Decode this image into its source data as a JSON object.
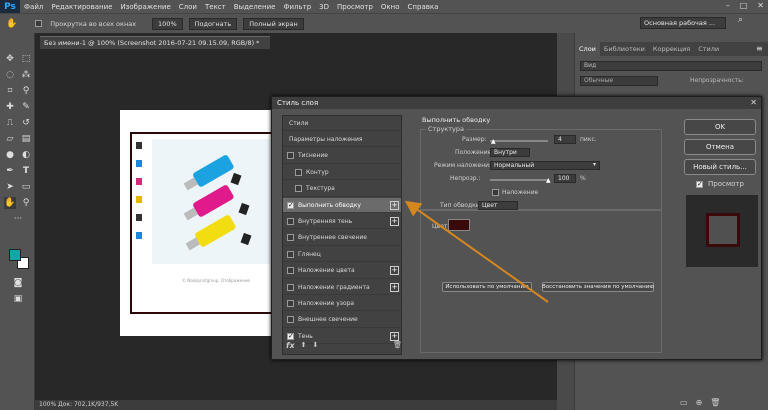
{
  "menubar": {
    "logo": "Ps",
    "items": [
      "Файл",
      "Редактирование",
      "Изображение",
      "Слои",
      "Текст",
      "Выделение",
      "Фильтр",
      "3D",
      "Просмотр",
      "Окно",
      "Справка"
    ]
  },
  "options": {
    "scroll_all_windows": "Прокрутка во всех окнах",
    "zoom": "100%",
    "fit_button": "Подогнать",
    "fullscreen_button": "Полный экран"
  },
  "search_placeholder": "Основная рабочая ...",
  "doc_tab": "Без имени-1 @ 100% (Screenshot 2016-07-21 09.15.09, RGB/8) *",
  "statusbar": "100%      Док: 702,1K/937,5K",
  "panel_tabs": [
    "Слои",
    "Библиотеки",
    "Коррекция",
    "Стили"
  ],
  "layers_panel": {
    "search": "Вид",
    "mode": "Обычные",
    "opacity_label": "Непрозрачность:"
  },
  "canvas_caption": "© Nakoprintgroup. Отображение",
  "dialog": {
    "title": "Стиль слоя",
    "styles": [
      {
        "label": "Стили",
        "check": false,
        "plus": false,
        "indent": false,
        "selected": false
      },
      {
        "label": "Параметры наложения",
        "check": false,
        "plus": false,
        "indent": false,
        "selected": false
      },
      {
        "label": "Тиснение",
        "check": true,
        "checked": false,
        "plus": false,
        "indent": false,
        "selected": false
      },
      {
        "label": "Контур",
        "check": true,
        "checked": false,
        "plus": false,
        "indent": true,
        "selected": false
      },
      {
        "label": "Текстура",
        "check": true,
        "checked": false,
        "plus": false,
        "indent": true,
        "selected": false
      },
      {
        "label": "Выполнить обводку",
        "check": true,
        "checked": true,
        "plus": true,
        "indent": false,
        "selected": true
      },
      {
        "label": "Внутренняя тень",
        "check": true,
        "checked": false,
        "plus": true,
        "indent": false,
        "selected": false
      },
      {
        "label": "Внутреннее свечение",
        "check": true,
        "checked": false,
        "plus": false,
        "indent": false,
        "selected": false
      },
      {
        "label": "Глянец",
        "check": true,
        "checked": false,
        "plus": false,
        "indent": false,
        "selected": false
      },
      {
        "label": "Наложение цвета",
        "check": true,
        "checked": false,
        "plus": true,
        "indent": false,
        "selected": false
      },
      {
        "label": "Наложение градиента",
        "check": true,
        "checked": false,
        "plus": true,
        "indent": false,
        "selected": false
      },
      {
        "label": "Наложение узора",
        "check": true,
        "checked": false,
        "plus": false,
        "indent": false,
        "selected": false
      },
      {
        "label": "Внешнее свечение",
        "check": true,
        "checked": false,
        "plus": false,
        "indent": false,
        "selected": false
      },
      {
        "label": "Тень",
        "check": true,
        "checked": true,
        "plus": true,
        "indent": false,
        "selected": false
      }
    ],
    "fx_label": "fx",
    "stroke": {
      "heading": "Выполнить обводку",
      "structure": "Структура",
      "size_label": "Размер:",
      "size_value": "4",
      "size_unit": "пикс.",
      "position_label": "Положение:",
      "position_value": "Внутри",
      "blend_label": "Режим наложения:",
      "blend_value": "Нормальный",
      "opacity_label": "Непрозр.:",
      "opacity_value": "100",
      "opacity_unit": "%",
      "overprint_label": "Наложение",
      "fill_type_label": "Тип обводки:",
      "fill_type_value": "Цвет",
      "color_label": "Цвет:",
      "stroke_color": "#3a0a0a"
    },
    "default_button": "Использовать по умолчанию",
    "reset_button": "Восстановить значения по умолчанию",
    "ok": "OK",
    "cancel": "Отмена",
    "new_style": "Новый стиль...",
    "preview": "Просмотр"
  },
  "colors": {
    "foreground": "#11a7a7",
    "background": "#ffffff",
    "arrow": "#d4861f",
    "frame": "#2a0808"
  }
}
